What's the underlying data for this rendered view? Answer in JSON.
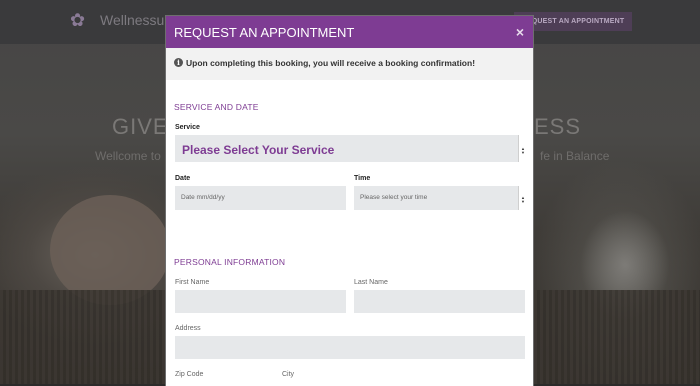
{
  "background": {
    "logo_text": "Wellnessum",
    "request_button": "REQUEST AN APPOINTMENT",
    "hero_title_left": "GIVE",
    "hero_title_right": "ESS",
    "hero_sub_left": "Wellcome to",
    "hero_sub_right": "fe in Balance"
  },
  "modal": {
    "title": "REQUEST AN APPOINTMENT",
    "close_symbol": "×",
    "info_text": "Upon completing this booking, you will receive a booking confirmation!",
    "section_service": "SERVICE AND DATE",
    "service_label": "Service",
    "service_value": "Please Select Your Service",
    "date_label": "Date",
    "date_placeholder": "Date mm/dd/yy",
    "time_label": "Time",
    "time_value": "Please select your time",
    "section_personal": "PERSONAL INFORMATION",
    "first_name_label": "First Name",
    "last_name_label": "Last Name",
    "address_label": "Address",
    "zip_label": "Zip Code",
    "city_label": "City"
  },
  "colors": {
    "brand_purple": "#7e3c93",
    "field_bg": "#e6e8ea"
  }
}
